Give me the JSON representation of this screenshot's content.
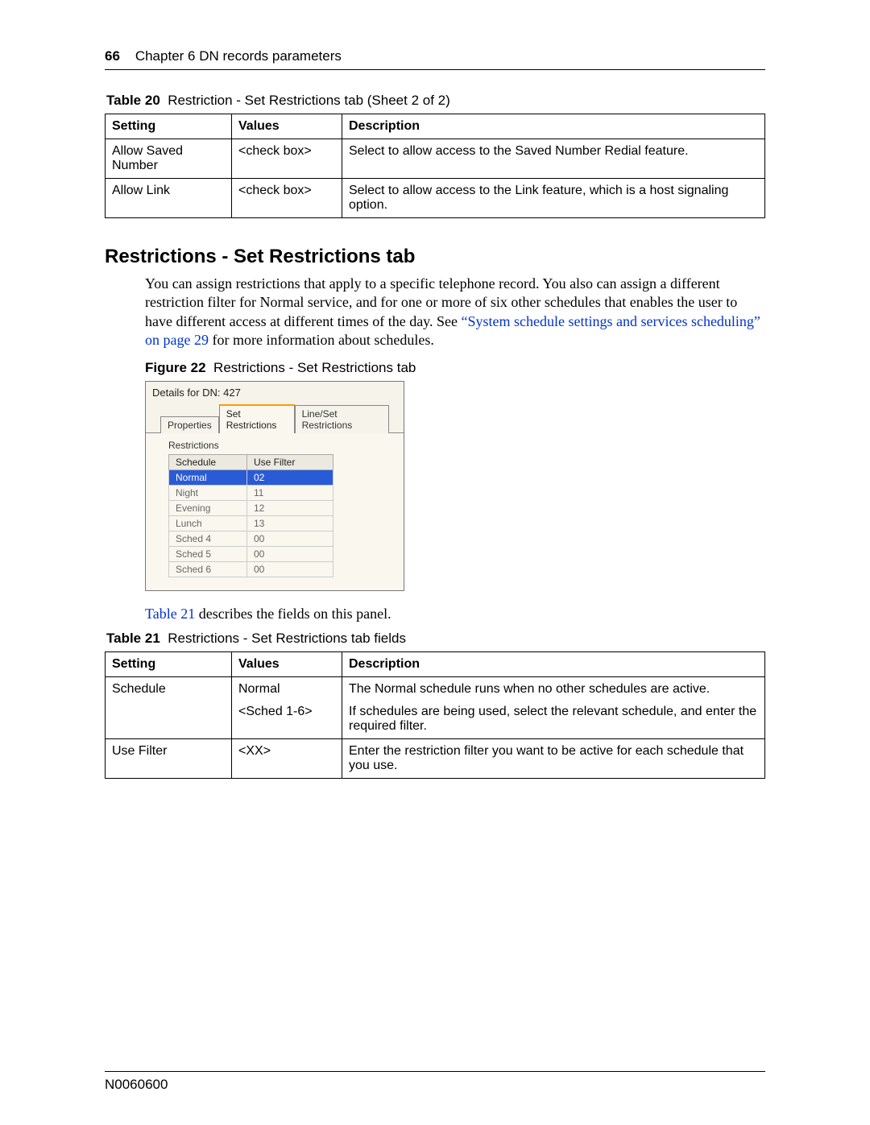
{
  "header": {
    "page_number": "66",
    "chapter": "Chapter 6  DN records parameters"
  },
  "table20": {
    "label": "Table 20",
    "caption": "Restriction - Set Restrictions tab (Sheet 2 of 2)",
    "columns": [
      "Setting",
      "Values",
      "Description"
    ],
    "rows": [
      {
        "setting": "Allow Saved Number",
        "values": "<check box>",
        "description": "Select to allow access to the Saved Number Redial feature."
      },
      {
        "setting": "Allow Link",
        "values": "<check box>",
        "description": "Select to allow access to the Link feature, which is a host signaling option."
      }
    ]
  },
  "section": {
    "heading": "Restrictions - Set Restrictions tab",
    "para_pre": "You can assign restrictions that apply to a specific telephone record. You also can assign a different restriction filter for Normal service, and for one or more of six other schedules that enables the user to have different access at different times of the day. See ",
    "link": "“System schedule settings and services scheduling” on page 29",
    "para_post": " for more information about schedules."
  },
  "figure22": {
    "label": "Figure 22",
    "caption": "Restrictions - Set Restrictions tab"
  },
  "ui": {
    "title": "Details for DN: 427",
    "tabs": [
      "Properties",
      "Set Restrictions",
      "Line/Set Restrictions"
    ],
    "active_tab": 1,
    "group_label": "Restrictions",
    "columns": [
      "Schedule",
      "Use Filter"
    ],
    "rows": [
      {
        "schedule": "Normal",
        "filter": "02",
        "selected": true
      },
      {
        "schedule": "Night",
        "filter": "11",
        "selected": false
      },
      {
        "schedule": "Evening",
        "filter": "12",
        "selected": false
      },
      {
        "schedule": "Lunch",
        "filter": "13",
        "selected": false
      },
      {
        "schedule": "Sched 4",
        "filter": "00",
        "selected": false
      },
      {
        "schedule": "Sched 5",
        "filter": "00",
        "selected": false
      },
      {
        "schedule": "Sched 6",
        "filter": "00",
        "selected": false
      }
    ]
  },
  "para2_pre": "Table 21",
  "para2_post": " describes the fields on this panel.",
  "table21": {
    "label": "Table 21",
    "caption": "Restrictions - Set Restrictions tab fields",
    "columns": [
      "Setting",
      "Values",
      "Description"
    ],
    "rows": [
      {
        "setting": "Schedule",
        "values_line1": "Normal",
        "values_line2": "<Sched 1-6>",
        "desc_line1": "The Normal schedule runs when no other schedules are active.",
        "desc_line2": "If schedules are being used, select the relevant schedule, and enter the required filter."
      },
      {
        "setting": "Use Filter",
        "values_line1": "<XX>",
        "values_line2": "",
        "desc_line1": "Enter the restriction filter you want to be active for each schedule that you use.",
        "desc_line2": ""
      }
    ]
  },
  "footer_code": "N0060600"
}
